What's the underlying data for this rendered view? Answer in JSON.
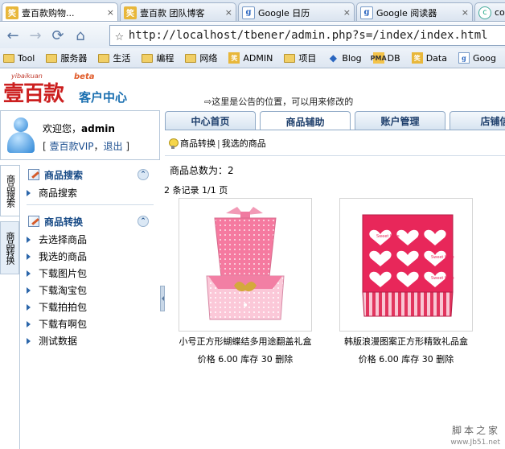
{
  "browser": {
    "tabs": [
      {
        "label": "壹百款购物...",
        "icon": "yibaikuan-icon",
        "active": true
      },
      {
        "label": "壹百款 团队博客",
        "icon": "yibaikuan-icon",
        "active": false
      },
      {
        "label": "Google 日历",
        "icon": "google-icon",
        "active": false
      },
      {
        "label": "Google 阅读器",
        "icon": "google-icon",
        "active": false
      },
      {
        "label": "cool",
        "icon": "cool-icon",
        "active": false
      }
    ],
    "close_glyph": "×",
    "url": "http://localhost/tbener/admin.php?s=/index/index.html",
    "bookmarks": [
      "Tool",
      "服务器",
      "生活",
      "编程",
      "网络",
      "ADMIN",
      "项目",
      "Blog",
      "DB",
      "Data",
      "Goog"
    ]
  },
  "header": {
    "logo_pinyin": "yibaikuan",
    "logo_brand": "壹百款",
    "logo_beta": "beta",
    "logo_center": "客户中心",
    "notice": "⇨这里是公告的位置，可以用来修改的"
  },
  "user": {
    "welcome_prefix": "欢迎您，",
    "username": "admin",
    "bracket_open": "[",
    "vip": "壹百款VIP",
    "comma": "，",
    "logout": "退出",
    "bracket_close": "]"
  },
  "sidebar": {
    "vtabs": [
      "商品搜索",
      "商品转换"
    ],
    "sections": [
      {
        "title": "商品搜索",
        "items": [
          "商品搜索"
        ]
      },
      {
        "title": "商品转换",
        "items": [
          "去选择商品",
          "我选的商品",
          "下载图片包",
          "下载淘宝包",
          "下载拍拍包",
          "下载有啊包",
          "测试数据"
        ]
      }
    ],
    "collapse_glyph": "⌃"
  },
  "main": {
    "tabs": [
      "中心首页",
      "商品辅助",
      "账户管理",
      "店铺信"
    ],
    "active_tab": 1,
    "subnav": [
      "商品转换",
      "我选的商品"
    ],
    "subnav_sep": "|",
    "total": "商品总数为：2",
    "records": "2 条记录 1/1 页",
    "products": [
      {
        "name": "小号正方形蝴蝶结多用途翻盖礼盒",
        "price_label": "价格",
        "price": "6.00",
        "stock_label": "库存",
        "stock": "30",
        "delete": "删除"
      },
      {
        "name": "韩版浪漫图案正方形精致礼品盒",
        "price_label": "价格",
        "price": "6.00",
        "stock_label": "库存",
        "stock": "30",
        "delete": "删除"
      }
    ],
    "sweet_love": "Sweet Love"
  },
  "watermark": {
    "line1": "脚本之家",
    "line2": "www.Jb51.net"
  }
}
